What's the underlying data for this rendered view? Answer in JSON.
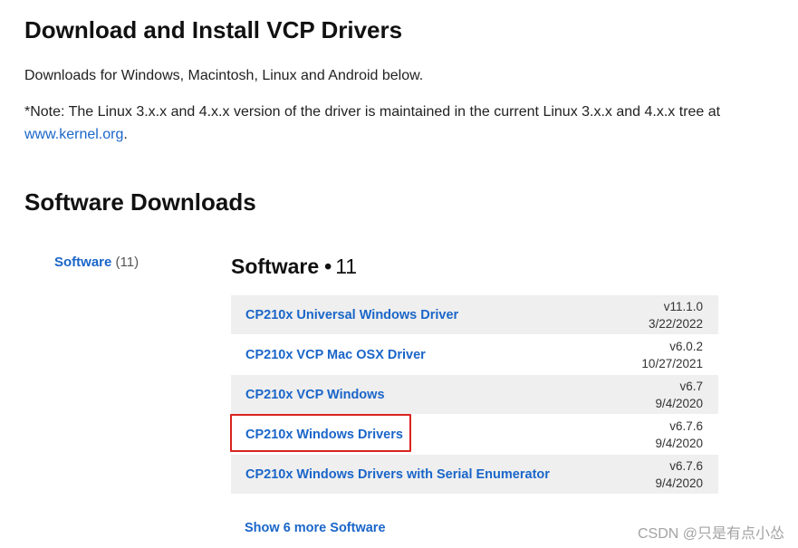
{
  "header": {
    "title": "Download and Install VCP Drivers"
  },
  "intro": {
    "line1": "Downloads for Windows, Macintosh, Linux and Android below.",
    "note_text": "*Note: The Linux 3.x.x and 4.x.x version of the driver is maintained in the current Linux 3.x.x and 4.x.x tree at ",
    "note_link": "www.kernel.org",
    "note_end": "."
  },
  "section": {
    "title": "Software Downloads"
  },
  "filter": {
    "label": "Software",
    "count": "(11)"
  },
  "list": {
    "title": "Software",
    "dot": "•",
    "count": "11",
    "items": [
      {
        "name": "CP210x Universal Windows Driver",
        "version": "v11.1.0",
        "date": "3/22/2022"
      },
      {
        "name": "CP210x VCP Mac OSX Driver",
        "version": "v6.0.2",
        "date": "10/27/2021"
      },
      {
        "name": "CP210x VCP Windows",
        "version": "v6.7",
        "date": "9/4/2020"
      },
      {
        "name": "CP210x Windows Drivers",
        "version": "v6.7.6",
        "date": "9/4/2020"
      },
      {
        "name": "CP210x Windows Drivers with Serial Enumerator",
        "version": "v6.7.6",
        "date": "9/4/2020"
      }
    ],
    "show_more": "Show 6 more Software"
  },
  "watermark": "CSDN @只是有点小怂",
  "colors": {
    "link": "#1a66c9",
    "row_alt": "#efefef",
    "highlight": "#d9231f"
  }
}
